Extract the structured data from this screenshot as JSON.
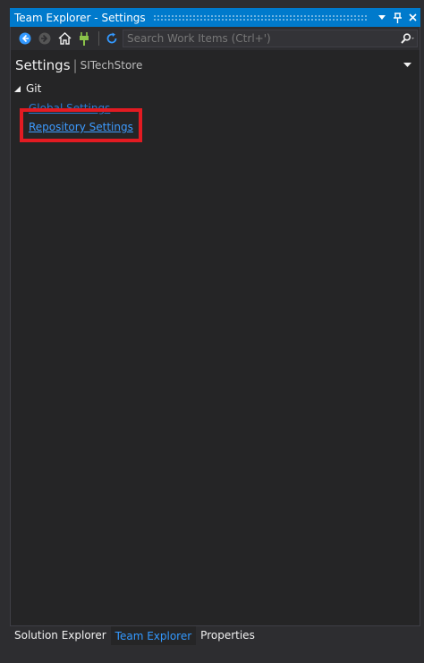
{
  "window": {
    "title": "Team Explorer - Settings"
  },
  "toolbar": {
    "search_placeholder": "Search Work Items (Ctrl+')"
  },
  "header": {
    "page_title": "Settings",
    "separator": "|",
    "context": "SITechStore"
  },
  "section": {
    "label": "Git",
    "links": [
      {
        "label": "Global Settings"
      },
      {
        "label": "Repository Settings"
      }
    ]
  },
  "tabs": [
    {
      "label": "Solution Explorer",
      "active": false
    },
    {
      "label": "Team Explorer",
      "active": true
    },
    {
      "label": "Properties",
      "active": false
    }
  ],
  "colors": {
    "accent": "#007acc",
    "link": "#3399ff",
    "highlight": "#e21b22",
    "background": "#252526"
  },
  "icons": [
    "back-icon",
    "forward-icon",
    "home-icon",
    "connect-icon",
    "refresh-icon",
    "search-icon",
    "dropdown-arrow-icon",
    "pin-icon",
    "close-icon",
    "collapse-triangle-icon"
  ]
}
